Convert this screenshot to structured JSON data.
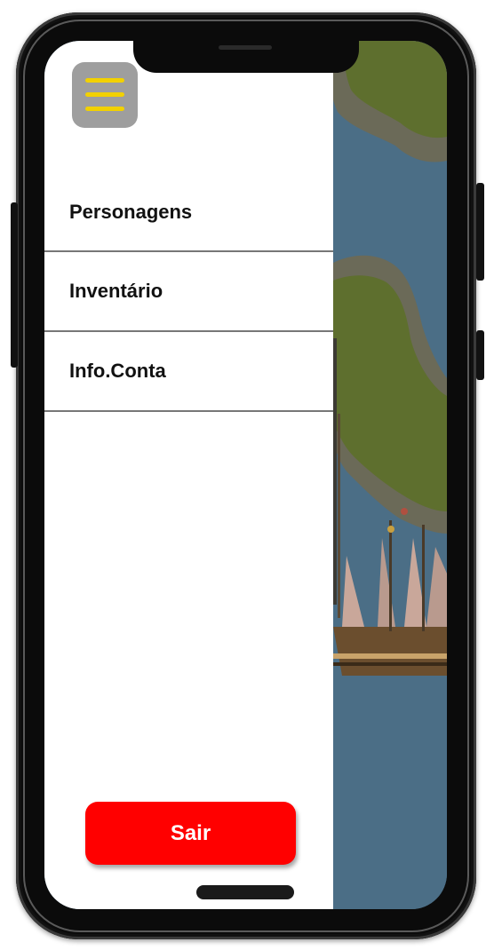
{
  "menu": {
    "items": [
      {
        "label": "Personagens"
      },
      {
        "label": "Inventário"
      },
      {
        "label": "Info.Conta"
      }
    ]
  },
  "logout": {
    "label": "Sair"
  },
  "colors": {
    "logout_button": "#ff0000",
    "menu_button_bg": "#9e9e9e",
    "menu_button_bars": "#f2d100",
    "water": "#4b6e86",
    "grass": "#5e6f2e"
  },
  "icons": {
    "menu_toggle": "hamburger-icon"
  }
}
